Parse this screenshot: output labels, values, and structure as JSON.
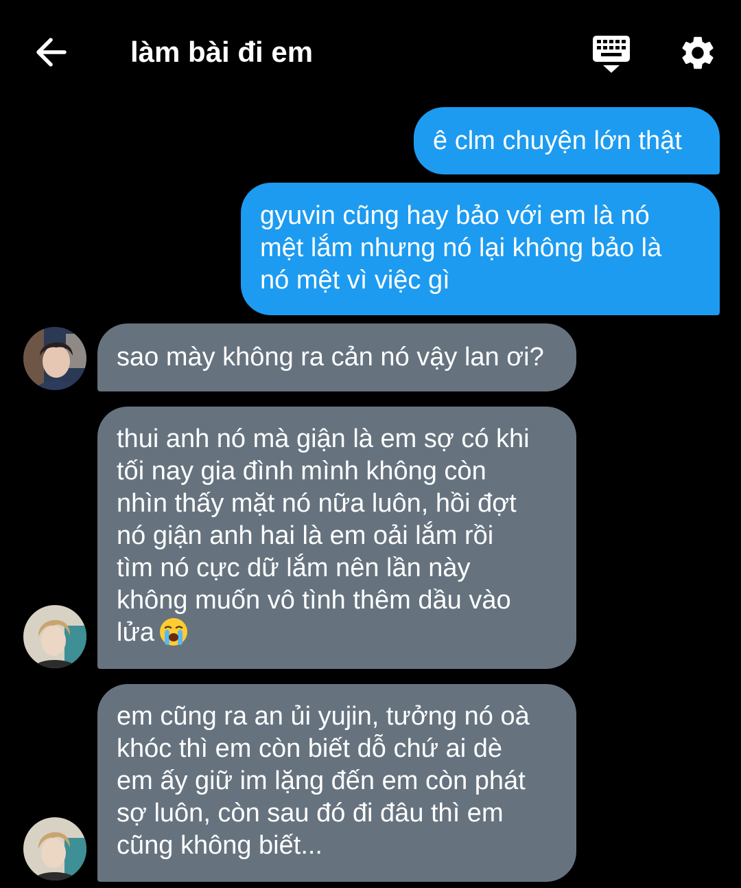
{
  "header": {
    "back_icon": "arrow-left-icon",
    "title": "làm bài đi em",
    "keyboard_icon": "keyboard-icon",
    "settings_icon": "gear-icon"
  },
  "colors": {
    "background": "#000000",
    "sent_bubble": "#1d9bf0",
    "received_bubble": "#66737f",
    "text": "#ffffff"
  },
  "messages": [
    {
      "side": "sent",
      "lines": [
        "ê clm chuyện lớn thật"
      ]
    },
    {
      "side": "sent",
      "lines": [
        "gyuvin cũng hay bảo với em là nó",
        "mệt lắm nhưng nó lại không bảo là",
        "nó mệt vì việc gì"
      ]
    },
    {
      "side": "received",
      "lines": [
        "sao mày không ra cản nó vậy lan ơi?"
      ]
    },
    {
      "side": "received",
      "lines": [
        "thui anh nó mà giận là em sợ có khi",
        "tối nay gia đình mình không còn",
        "nhìn thấy mặt nó nữa luôn, hồi đợt",
        "nó giận anh hai là em oải lắm rồi",
        "tìm nó cực dữ lắm nên lần này",
        "không muốn vô tình thêm dầu vào",
        "lửa"
      ],
      "emoji": "loudly-crying-face-icon"
    },
    {
      "side": "received",
      "lines": [
        "em cũng ra an ủi yujin, tưởng nó oà",
        "khóc thì em còn biết dỗ chứ ai dè",
        "em ấy giữ im lặng đến em còn phát",
        "sợ luôn, còn sau đó đi đâu thì em",
        "cũng không biết..."
      ]
    }
  ]
}
